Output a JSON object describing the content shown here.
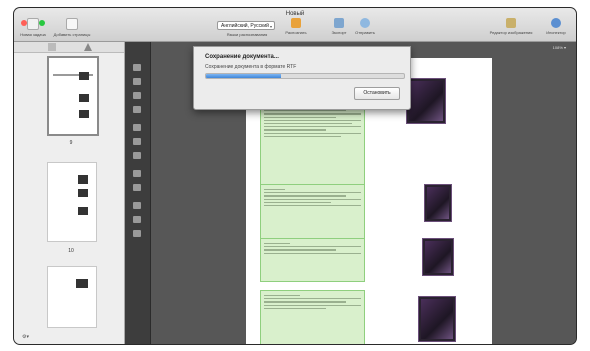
{
  "window": {
    "title": "Новый"
  },
  "toolbar": {
    "new_task": "Новая задача",
    "add_pages": "Добавить страницы",
    "language_select": "Английский, Русский",
    "recognition_language": "Языки распознавания",
    "recognize": "Распознать",
    "export": "Экспорт",
    "send": "Отправить",
    "image_editor": "Редактор изображения",
    "inspector": "Инспектор"
  },
  "sidebar": {
    "page_numbers": [
      "9",
      "10"
    ]
  },
  "document": {
    "zoom": "108%"
  },
  "dialog": {
    "title": "Сохранение документа...",
    "subtitle": "Сохранение документа в формате RTF",
    "progress": 0.38,
    "stop_label": "Остановить"
  },
  "colors": {
    "progress": "#3f86d8",
    "highlight": "#d9f0cc",
    "highlight_border": "#8fcf7e"
  }
}
